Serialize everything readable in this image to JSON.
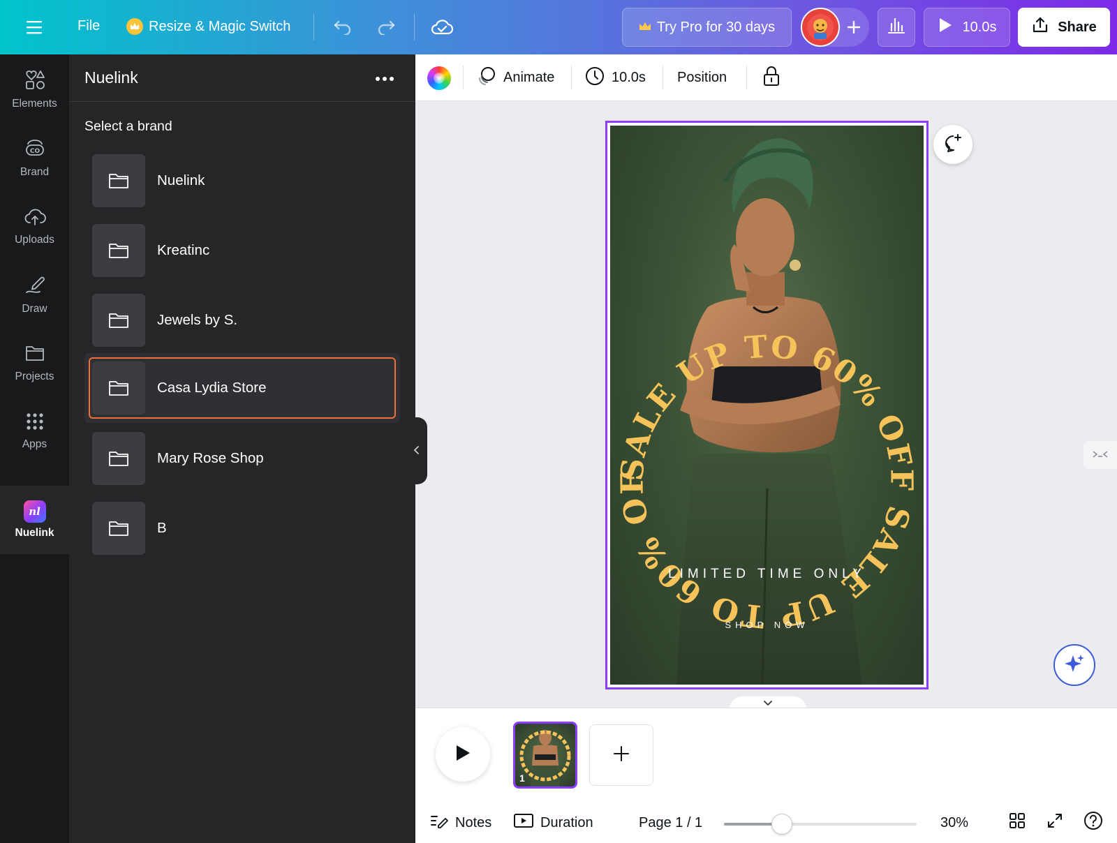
{
  "topbar": {
    "file": "File",
    "resize": "Resize & Magic Switch",
    "try_pro": "Try Pro for 30 days",
    "duration": "10.0s",
    "share": "Share"
  },
  "rail": {
    "items": [
      {
        "label": "Elements",
        "icon": "shapes-icon"
      },
      {
        "label": "Brand",
        "icon": "brand-icon"
      },
      {
        "label": "Uploads",
        "icon": "cloud-upload-icon"
      },
      {
        "label": "Draw",
        "icon": "pen-icon"
      },
      {
        "label": "Projects",
        "icon": "folder-icon"
      },
      {
        "label": "Apps",
        "icon": "grid-icon"
      },
      {
        "label": "Nuelink",
        "icon": "nuelink-logo"
      }
    ],
    "nuelink_logo_text": "nl"
  },
  "panel": {
    "title": "Nuelink",
    "subtitle": "Select a brand",
    "brands": [
      "Nuelink",
      "Kreatinc",
      "Jewels by S.",
      "Casa Lydia Store",
      "Mary Rose Shop",
      "B"
    ],
    "selected_index": 3
  },
  "ctxbar": {
    "animate": "Animate",
    "duration": "10.0s",
    "position": "Position"
  },
  "design": {
    "arc_text": "SALE UP TO 60% OFF SALE UP TO 60% OFF",
    "limited": "LIMITED TIME ONLY",
    "shop": "SHOP NOW",
    "accent_color": "#f5c35a",
    "bg_color": "#3c5236"
  },
  "timeline": {
    "page_number": "1"
  },
  "footer": {
    "notes": "Notes",
    "duration": "Duration",
    "page": "Page 1 / 1",
    "zoom": "30%",
    "zoom_level": 0.3
  },
  "colors": {
    "accent": "#8b3dff",
    "selection": "#f16d3b",
    "panel_bg": "#252627",
    "rail_bg": "#18191b"
  }
}
